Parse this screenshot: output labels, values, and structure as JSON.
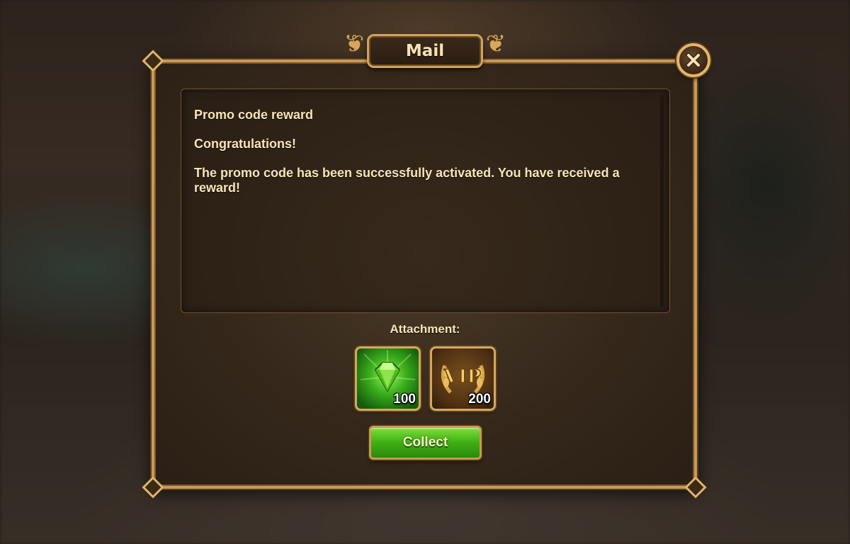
{
  "dialog": {
    "title": "Mail",
    "close_icon": "close-icon"
  },
  "message": {
    "lines": [
      "Promo code reward",
      "Congratulations!",
      "The promo code has been successfully activated. You have received a reward!"
    ]
  },
  "attachments": {
    "label": "Attachment:",
    "items": [
      {
        "icon": "emerald-icon",
        "quantity": "100"
      },
      {
        "icon": "vip-points-icon",
        "quantity": "200"
      }
    ]
  },
  "actions": {
    "collect_label": "Collect"
  },
  "colors": {
    "panel_border": "#c89a55",
    "text": "#f7e6b8",
    "collect_green": "#3fae14"
  }
}
